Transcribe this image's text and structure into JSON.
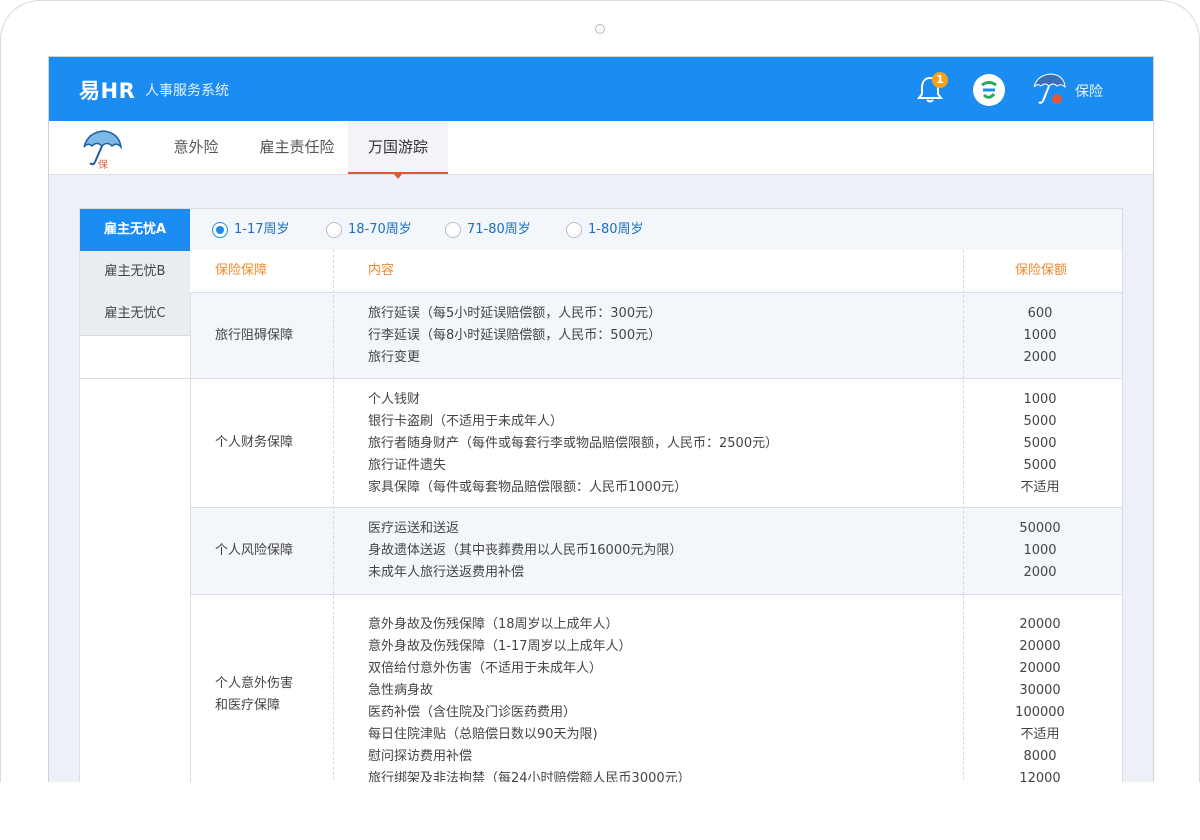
{
  "header": {
    "logo": "易HR",
    "subtitle": "人事服务系统",
    "notification_count": "1",
    "user_label": "保险"
  },
  "tabs": [
    "意外险",
    "雇主责任险",
    "万国游踪"
  ],
  "active_tab": 2,
  "logo_badge": "保",
  "sidebar": [
    "雇主无忧A",
    "雇主无忧B",
    "雇主无忧C"
  ],
  "age_options": [
    "1-17周岁",
    "18-70周岁",
    "71-80周岁",
    "1-80周岁"
  ],
  "table": {
    "headers": [
      "保险保障",
      "内容",
      "保险保额"
    ],
    "rows": [
      {
        "category": "旅行阻碍保障",
        "items": [
          "旅行延误（每5小时延误赔偿额，人民币：300元）",
          "行李延误（每8小时延误赔偿额，人民币：500元）",
          "旅行变更"
        ],
        "values": [
          "600",
          "1000",
          "2000"
        ]
      },
      {
        "category": "个人财务保障",
        "items": [
          "个人钱财",
          "银行卡盗刷（不适用于未成年人）",
          "旅行者随身财产（每件或每套行李或物品赔偿限额，人民币：2500元）",
          "旅行证件遗失",
          "家具保障（每件或每套物品赔偿限额：人民币1000元）"
        ],
        "values": [
          "1000",
          "5000",
          "5000",
          "5000",
          "不适用"
        ]
      },
      {
        "category": "个人风险保障",
        "items": [
          "医疗运送和送返",
          "身故遗体送返（其中丧葬费用以人民币16000元为限）",
          "未成年人旅行送返费用补偿"
        ],
        "values": [
          "50000",
          "1000",
          "2000"
        ]
      },
      {
        "category_lines": [
          "个人意外伤害",
          "和医疗保障"
        ],
        "items": [
          "意外身故及伤残保障（18周岁以上成年人）",
          "意外身故及伤残保障（1-17周岁以上成年人）",
          "双倍给付意外伤害（不适用于未成年人）",
          "急性病身故",
          "医药补偿（含住院及门诊医药费用）",
          "每日住院津贴（总赔偿日数以90天为限)",
          "慰问探访费用补偿",
          "旅行绑架及非法拘禁（每24小时赔偿额人民币3000元）"
        ],
        "values": [
          "20000",
          "20000",
          "20000",
          "30000",
          "100000",
          "不适用",
          "8000",
          "12000"
        ]
      }
    ]
  }
}
